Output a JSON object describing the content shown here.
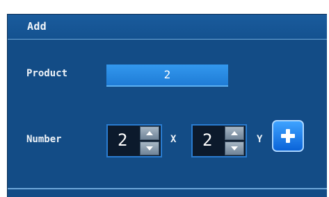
{
  "dialog": {
    "title": "Add"
  },
  "form": {
    "product_label": "Product",
    "product_value": "2",
    "number_label": "Number",
    "x_value": "2",
    "x_label": "X",
    "y_value": "2",
    "y_label": "Y"
  },
  "icons": {
    "spin_up": "chevron-up-icon",
    "spin_down": "chevron-down-icon",
    "add": "plus-icon"
  },
  "colors": {
    "panel_bg": "#134c86",
    "field_accent": "#2a8be6",
    "add_button": "#1e86f0"
  }
}
